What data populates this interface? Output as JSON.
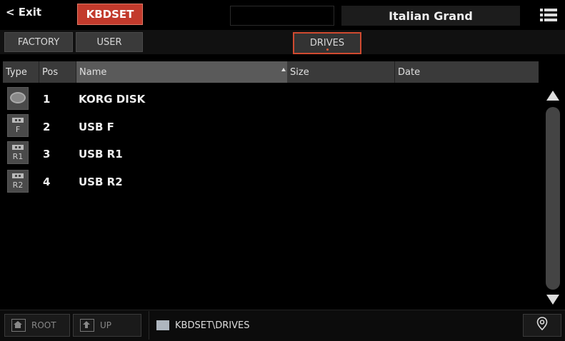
{
  "topbar": {
    "exit_label": "< Exit",
    "set_label": "KBDSET",
    "sound_name": "Italian Grand"
  },
  "tabs": {
    "factory": "FACTORY",
    "user": "USER",
    "drives": "DRIVES"
  },
  "table": {
    "headers": {
      "type": "Type",
      "pos": "Pos",
      "name": "Name",
      "size": "Size",
      "date": "Date"
    },
    "rows": [
      {
        "type_icon": "disk-icon",
        "type_label": "",
        "pos": "1",
        "name": "KORG DISK"
      },
      {
        "type_icon": "usb-icon",
        "type_label": "F",
        "pos": "2",
        "name": "USB F"
      },
      {
        "type_icon": "usb-icon",
        "type_label": "R1",
        "pos": "3",
        "name": "USB R1"
      },
      {
        "type_icon": "usb-icon",
        "type_label": "R2",
        "pos": "4",
        "name": "USB R2"
      }
    ]
  },
  "bottombar": {
    "root_label": "ROOT",
    "up_label": "UP",
    "path": "KBDSET\\DRIVES"
  },
  "colors": {
    "accent_red": "#c23a2c",
    "selected_border": "#d04a30",
    "background": "#000000"
  }
}
